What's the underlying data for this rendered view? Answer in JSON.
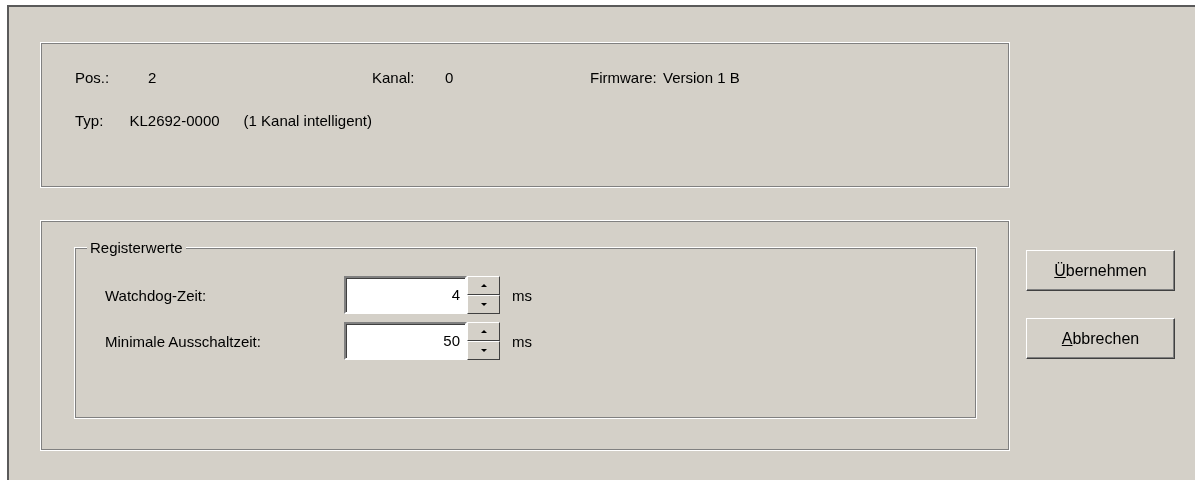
{
  "info": {
    "rows": [
      [
        {
          "label": "Pos.:",
          "value": "2"
        },
        {
          "label": "Kanal:",
          "value": "0"
        },
        {
          "label": "Firmware:",
          "value": "Version 1 B"
        }
      ],
      [
        {
          "label": "Typ:",
          "value": "KL2692-0000",
          "note": "(1 Kanal intelligent)"
        }
      ]
    ]
  },
  "registers": {
    "title": "Registerwerte",
    "fields": [
      {
        "label": "Watchdog-Zeit:",
        "value": "4",
        "unit": "ms"
      },
      {
        "label": "Minimale Ausschaltzeit:",
        "value": "50",
        "unit": "ms"
      }
    ]
  },
  "buttons": [
    {
      "access_key": "Ü",
      "label_rest": "bernehmen"
    },
    {
      "access_key": "A",
      "label_rest": "bbrechen"
    }
  ]
}
